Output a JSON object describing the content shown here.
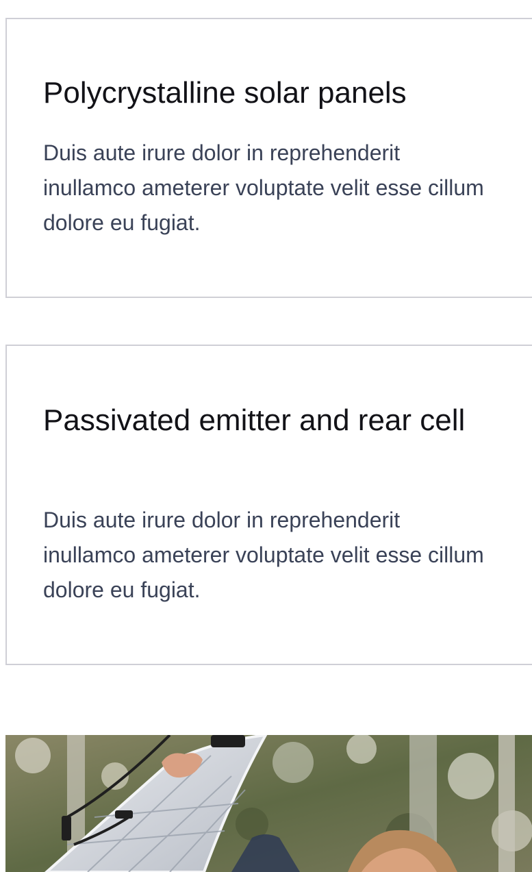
{
  "cards": [
    {
      "title": "Polycrystalline solar panels",
      "text": "Duis aute irure dolor in reprehenderit inullamco ameterer voluptate velit esse cillum dolore eu fugiat."
    },
    {
      "title": "Passivated emitter and rear cell",
      "text": "Duis aute irure dolor in reprehenderit inullamco ameterer voluptate velit esse cillum dolore eu fugiat."
    }
  ],
  "colors": {
    "card_border": "#cfcfd6",
    "title": "#121217",
    "body_text": "#3a4257"
  }
}
